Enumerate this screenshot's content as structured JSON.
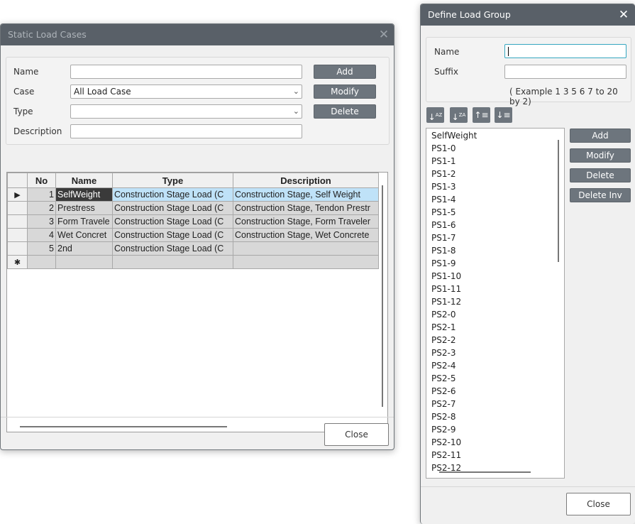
{
  "static_load_cases": {
    "title": "Static Load Cases",
    "close_glyph": "✕",
    "form": {
      "name_label": "Name",
      "name_value": "",
      "case_label": "Case",
      "case_value": "All Load Case",
      "type_label": "Type",
      "type_value": "",
      "description_label": "Description",
      "description_value": ""
    },
    "buttons": {
      "add": "Add",
      "modify": "Modify",
      "delete": "Delete",
      "close": "Close"
    },
    "table": {
      "headers": [
        "No",
        "Name",
        "Type",
        "Description"
      ],
      "rows": [
        {
          "marker": "▶",
          "no": "1",
          "name": "SelfWeight",
          "type": "Construction Stage Load (C",
          "description": "Construction Stage, Self Weight"
        },
        {
          "marker": "",
          "no": "2",
          "name": "Prestress",
          "type": "Construction Stage Load (C",
          "description": "Construction Stage, Tendon Prestr"
        },
        {
          "marker": "",
          "no": "3",
          "name": "Form Travele",
          "type": "Construction Stage Load (C",
          "description": "Construction Stage, Form Traveler"
        },
        {
          "marker": "",
          "no": "4",
          "name": "Wet Concret",
          "type": "Construction Stage Load (C",
          "description": "Construction Stage, Wet Concrete"
        },
        {
          "marker": "",
          "no": "5",
          "name": "2nd",
          "type": "Construction Stage Load (C",
          "description": ""
        }
      ],
      "new_row_marker": "✱"
    }
  },
  "define_load_group": {
    "title": "Define Load Group",
    "close_glyph": "✕",
    "name_label": "Name",
    "name_value": "",
    "suffix_label": "Suffix",
    "suffix_value": "",
    "example_text": "( Example 1 3 5 6 7 to 20 by 2)",
    "sort_icons": [
      "sort-ascending-icon",
      "sort-descending-icon",
      "move-up-icon",
      "move-down-icon"
    ],
    "buttons": {
      "add": "Add",
      "modify": "Modify",
      "delete": "Delete",
      "delete_inv": "Delete Inv",
      "close": "Close"
    },
    "groups": [
      "SelfWeight",
      "PS1-0",
      "PS1-1",
      "PS1-2",
      "PS1-3",
      "PS1-4",
      "PS1-5",
      "PS1-6",
      "PS1-7",
      "PS1-8",
      "PS1-9",
      "PS1-10",
      "PS1-11",
      "PS1-12",
      "PS2-0",
      "PS2-1",
      "PS2-2",
      "PS2-3",
      "PS2-4",
      "PS2-5",
      "PS2-6",
      "PS2-7",
      "PS2-8",
      "PS2-9",
      "PS2-10",
      "PS2-11",
      "PS2-12"
    ]
  }
}
